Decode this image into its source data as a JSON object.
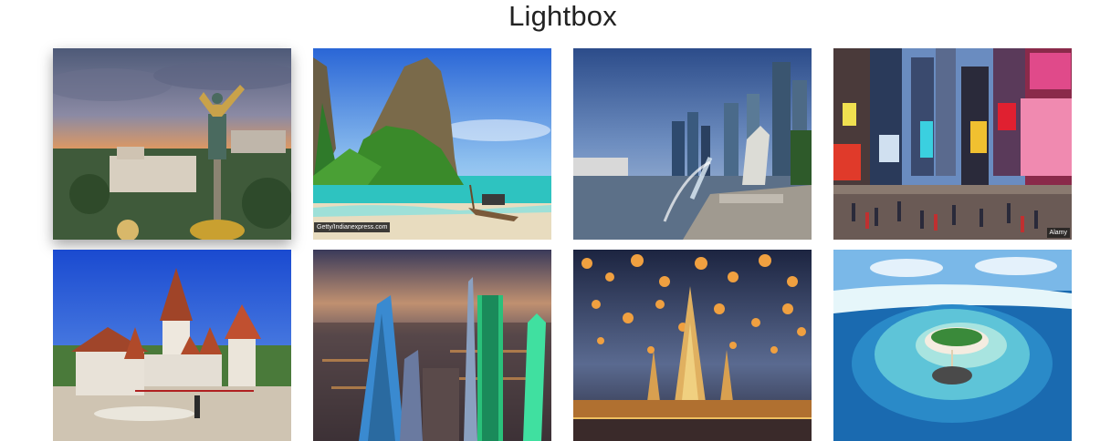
{
  "page": {
    "title": "Lightbox"
  },
  "gallery": {
    "items": [
      {
        "name": "Kyiv independence monument at sunset",
        "icon": "photo-kyiv",
        "active": true
      },
      {
        "name": "Thailand limestone island beach with longtail boat",
        "icon": "photo-thailand-beach",
        "credit": "Getty/Indianexpress.com"
      },
      {
        "name": "Singapore Merlion and skyline",
        "icon": "photo-singapore"
      },
      {
        "name": "Times Square New York",
        "icon": "photo-times-square",
        "credit": "Alamy"
      },
      {
        "name": "Fortified church village with sheep",
        "icon": "photo-village-church"
      },
      {
        "name": "Riyadh skyline at dusk",
        "icon": "photo-riyadh"
      },
      {
        "name": "Bangkok temple with sky lanterns",
        "icon": "photo-lanterns-temple"
      },
      {
        "name": "Maldives atoll resort",
        "icon": "photo-maldives"
      }
    ]
  }
}
